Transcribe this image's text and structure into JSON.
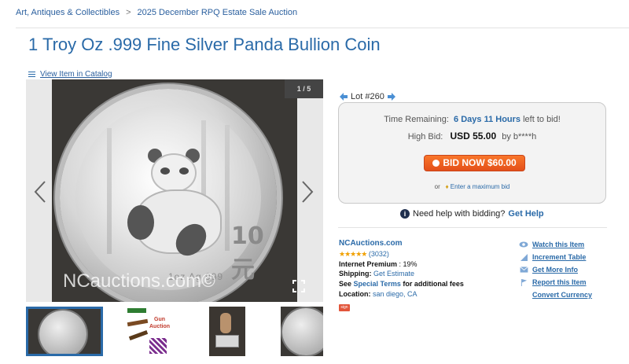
{
  "breadcrumb": {
    "items": [
      "Art, Antiques & Collectibles",
      "2025 December RPQ Estate Sale Auction"
    ],
    "separator": ">"
  },
  "item": {
    "title": "1 Troy Oz .999 Fine Silver Panda Bullion Coin",
    "catalog_link": "View Item in Catalog"
  },
  "gallery": {
    "counter": "1 / 5",
    "coin_denomination": "10元",
    "coin_weight_text": "1oz Ag 999",
    "watermark": "NCauctions.com©",
    "thumbnail_labels": [
      "Gun",
      "Auction"
    ]
  },
  "lot": {
    "label": "Lot #260"
  },
  "bidding": {
    "time_label": "Time Remaining:",
    "time_value": "6 Days 11 Hours",
    "time_suffix": "left to bid!",
    "highbid_label": "High Bid:",
    "highbid_amount": "USD 55.00",
    "highbid_by": "by b****h",
    "bid_button": "BID NOW $60.00",
    "maxbid_prefix": "or",
    "maxbid_link": "Enter a maximum bid"
  },
  "help": {
    "text": "Need help with bidding?",
    "link": "Get Help"
  },
  "seller": {
    "name": "NCAuctions.com",
    "stars": "★★★★★",
    "rating_count": "(3032)",
    "premium_label": "Internet Premium",
    "premium_value": ": 19%",
    "shipping_label": "Shipping:",
    "shipping_link": "Get Estimate",
    "see": "See",
    "terms_link": "Special Terms",
    "terms_suffix": "for additional fees",
    "location_label": "Location:",
    "location_value": "san diego, CA",
    "badge": "sign"
  },
  "actions": [
    {
      "icon": "eye-icon",
      "label": "Watch this Item"
    },
    {
      "icon": "chart-icon",
      "label": "Increment Table"
    },
    {
      "icon": "mail-icon",
      "label": "Get More Info"
    },
    {
      "icon": "flag-icon",
      "label": "Report this Item"
    },
    {
      "icon": "",
      "label": "Convert Currency"
    }
  ],
  "colors": {
    "link": "#2a6aa8",
    "bid_button": "#f26a21",
    "stars": "#f0a000"
  }
}
